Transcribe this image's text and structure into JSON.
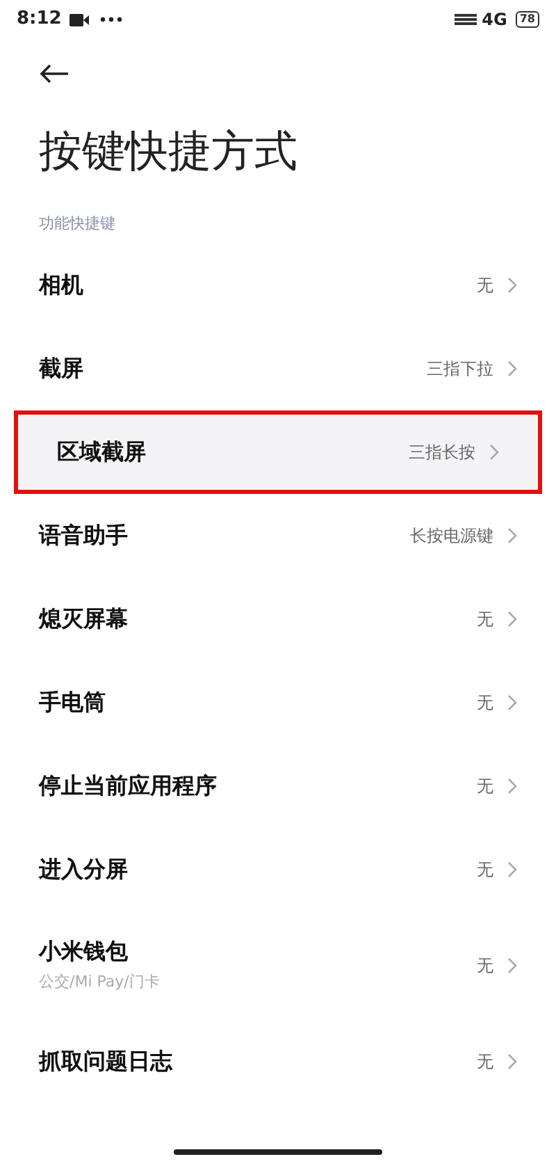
{
  "status_bar": {
    "time": "8:12",
    "network": "4G",
    "battery": "78"
  },
  "title": "按键快捷方式",
  "section": "功能快捷键",
  "items": [
    {
      "label": "相机",
      "value": "无",
      "highlighted": false
    },
    {
      "label": "截屏",
      "value": "三指下拉",
      "highlighted": false
    },
    {
      "label": "区域截屏",
      "value": "三指长按",
      "highlighted": true
    },
    {
      "label": "语音助手",
      "value": "长按电源键",
      "highlighted": false
    },
    {
      "label": "熄灭屏幕",
      "value": "无",
      "highlighted": false
    },
    {
      "label": "手电筒",
      "value": "无",
      "highlighted": false
    },
    {
      "label": "停止当前应用程序",
      "value": "无",
      "highlighted": false
    },
    {
      "label": "进入分屏",
      "value": "无",
      "highlighted": false
    },
    {
      "label": "小米钱包",
      "subtitle": "公交/Mi Pay/门卡",
      "value": "无",
      "highlighted": false
    },
    {
      "label": "抓取问题日志",
      "value": "无",
      "highlighted": false
    }
  ]
}
